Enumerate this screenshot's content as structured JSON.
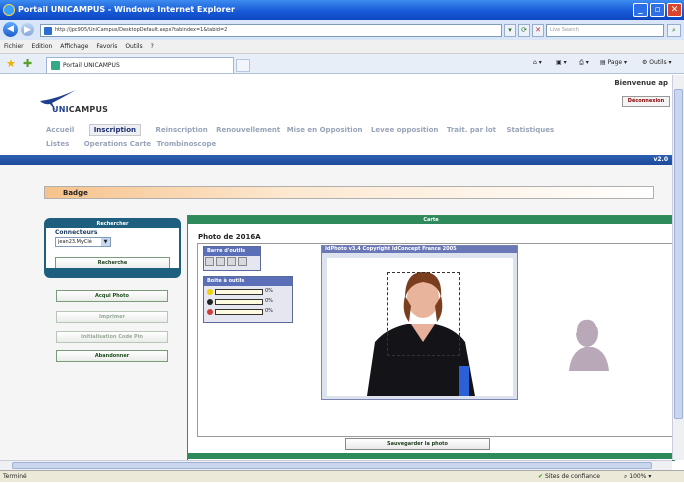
{
  "window": {
    "title": "Portail UNICAMPUS - Windows Internet Explorer"
  },
  "address": {
    "url": "http://jpc905/UniCampus/DesktopDefault.aspx?tabindex=1&tabid=2",
    "search_placeholder": "Live Search"
  },
  "menu": [
    "Fichier",
    "Edition",
    "Affichage",
    "Favoris",
    "Outils",
    "?"
  ],
  "tab": {
    "label": "Portail UNICAMPUS"
  },
  "tools": {
    "page": "Page",
    "outils": "Outils"
  },
  "header": {
    "welcome": "Bienvenue ap",
    "logout": "Déconnexion",
    "logo_prefix": "UNI",
    "logo_suffix": "CAMPUS"
  },
  "nav": {
    "row1": [
      "Accueil",
      "Inscription",
      "Reinscription",
      "Renouvellement",
      "Mise en Opposition",
      "Levee opposition",
      "Trait. par lot",
      "Statistiques"
    ],
    "row2": [
      "Listes",
      "Operations Carte",
      "Trombinoscope"
    ],
    "active": "Inscription",
    "version": "v2.0"
  },
  "badge": {
    "title": "Badge"
  },
  "search_panel": {
    "header": "Rechercher",
    "label": "Connecteurs",
    "selected": "jean23.MyClé",
    "button": "Recherche"
  },
  "actions": {
    "acquire": "Acqui Photo",
    "print": "Imprimer",
    "init": "Initialisation Code Pin",
    "abandon": "Abandonner"
  },
  "carte": {
    "header": "Carte",
    "photo_title": "Photo de 2016A",
    "save": "Sauvegarder la photo"
  },
  "toolbar_window": {
    "title": "Barre d'outils"
  },
  "toolbox_window": {
    "title": "Boite à outils",
    "sliders": [
      {
        "color": "#f2d200",
        "value": "0%"
      },
      {
        "color": "#222222",
        "value": "0%"
      },
      {
        "color": "#d23c3c",
        "value": "0%"
      }
    ]
  },
  "idphoto": {
    "title": "IdPhoto v3.4   Copyright IdConcept France 2005"
  },
  "status": {
    "left": "Terminé",
    "zone": "Sites de confiance",
    "zoom": "100%"
  }
}
